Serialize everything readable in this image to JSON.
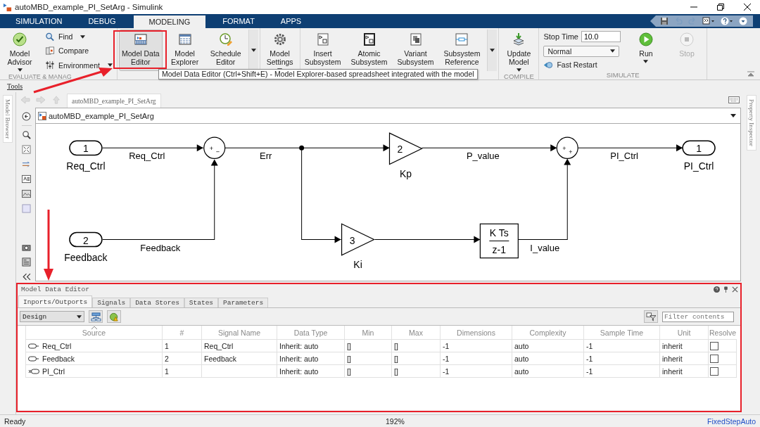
{
  "window": {
    "title": "autoMBD_example_PI_SetArg - Simulink"
  },
  "ribbon_tabs": [
    {
      "label": "SIMULATION",
      "selected": false
    },
    {
      "label": "DEBUG",
      "selected": false
    },
    {
      "label": "MODELING",
      "selected": true
    },
    {
      "label": "FORMAT",
      "selected": false
    },
    {
      "label": "APPS",
      "selected": false
    }
  ],
  "toolstrip": {
    "sections": [
      {
        "label": "EVALUATE & MANAG",
        "items": [
          {
            "kind": "big",
            "label": "Model\nAdvisor",
            "dropdown": true,
            "hovered": false,
            "disabled": false
          },
          {
            "kind": "small",
            "label": "Find",
            "dropdown": true
          },
          {
            "kind": "small",
            "label": "Compare",
            "dropdown": false
          },
          {
            "kind": "small",
            "label": "Environment",
            "dropdown": true
          }
        ]
      },
      {
        "items": [
          {
            "kind": "big",
            "label": "Model Data\nEditor",
            "dropdown": false,
            "hovered": true,
            "disabled": false
          },
          {
            "kind": "big",
            "label": "Model\nExplorer",
            "dropdown": false,
            "hovered": false,
            "disabled": false
          },
          {
            "kind": "big",
            "label": "Schedule\nEditor",
            "dropdown": false,
            "hovered": false,
            "disabled": false
          },
          {
            "kind": "more"
          }
        ]
      },
      {
        "items": [
          {
            "kind": "big",
            "label": "Model\nSettings",
            "dropdown": true,
            "hovered": false,
            "disabled": false
          }
        ]
      },
      {
        "items": [
          {
            "kind": "big",
            "label": "Insert\nSubsystem",
            "dropdown": false,
            "hovered": false,
            "disabled": false
          },
          {
            "kind": "big",
            "label": "Atomic\nSubsystem",
            "dropdown": false,
            "hovered": false,
            "disabled": false
          },
          {
            "kind": "big",
            "label": "Variant\nSubsystem",
            "dropdown": false,
            "hovered": false,
            "disabled": false
          },
          {
            "kind": "big",
            "label": "Subsystem\nReference",
            "dropdown": false,
            "hovered": false,
            "disabled": false
          },
          {
            "kind": "more"
          }
        ]
      },
      {
        "label": "COMPILE",
        "items": [
          {
            "kind": "big",
            "label": "Update\nModel",
            "dropdown": true,
            "hovered": false,
            "disabled": false
          }
        ]
      },
      {
        "label": "SIMULATE",
        "items": [
          {
            "kind": "stop_time",
            "label": "Stop Time",
            "value": "10.0"
          },
          {
            "kind": "select",
            "value": "Normal"
          },
          {
            "kind": "small",
            "label": "Fast Restart",
            "dropdown": false
          },
          {
            "kind": "big",
            "label": "Run",
            "dropdown": true,
            "hovered": false,
            "disabled": false
          },
          {
            "kind": "big",
            "label": "Stop",
            "dropdown": false,
            "hovered": false,
            "disabled": true
          }
        ]
      }
    ]
  },
  "tooltip": "Model Data Editor (Ctrl+Shift+E) - Model Explorer-based spreadsheet integrated with the model",
  "tools_label": "Tools",
  "side_tabs": {
    "left": "Model Browser",
    "right": "Property Inspector"
  },
  "editor": {
    "breadcrumb_tab": "autoMBD_example_PI_SetArg",
    "address": "autoMBD_example_PI_SetArg"
  },
  "diagram": {
    "blocks": [
      {
        "kind": "inport",
        "number": "1",
        "name": "Req_Ctrl"
      },
      {
        "kind": "inport",
        "number": "2",
        "name": "Feedback"
      },
      {
        "kind": "sum",
        "signs": [
          "+",
          "−"
        ]
      },
      {
        "kind": "gain",
        "value": "2",
        "name": "Kp"
      },
      {
        "kind": "gain",
        "value": "3",
        "name": "Ki"
      },
      {
        "kind": "discrete_integrator",
        "numerator": "K Ts",
        "denominator": "z-1"
      },
      {
        "kind": "sum",
        "signs": [
          "+",
          "+"
        ]
      },
      {
        "kind": "outport",
        "number": "1",
        "name": "PI_Ctrl"
      }
    ],
    "signals": [
      {
        "label": "Req_Ctrl"
      },
      {
        "label": "Feedback"
      },
      {
        "label": "Err"
      },
      {
        "label": "P_value"
      },
      {
        "label": "I_value"
      },
      {
        "label": "PI_Ctrl"
      }
    ]
  },
  "model_data_editor": {
    "title": "Model Data Editor",
    "tabs": [
      {
        "label": "Inports/Outports",
        "selected": true
      },
      {
        "label": "Signals",
        "selected": false
      },
      {
        "label": "Data Stores",
        "selected": false
      },
      {
        "label": "States",
        "selected": false
      },
      {
        "label": "Parameters",
        "selected": false
      }
    ],
    "view": "Design",
    "filter_placeholder": "Filter contents",
    "columns": [
      "Source",
      "#",
      "Signal Name",
      "Data Type",
      "Min",
      "Max",
      "Dimensions",
      "Complexity",
      "Sample Time",
      "Unit",
      "Resolve"
    ],
    "rows": [
      {
        "kind": "inport",
        "cells": [
          "Req_Ctrl",
          "1",
          "Req_Ctrl",
          "Inherit: auto",
          "[]",
          "[]",
          "-1",
          "auto",
          "-1",
          "inherit"
        ],
        "resolve": false
      },
      {
        "kind": "inport",
        "cells": [
          "Feedback",
          "2",
          "Feedback",
          "Inherit: auto",
          "[]",
          "[]",
          "-1",
          "auto",
          "-1",
          "inherit"
        ],
        "resolve": false
      },
      {
        "kind": "outport",
        "cells": [
          "PI_Ctrl",
          "1",
          null,
          "Inherit: auto",
          "[]",
          "[]",
          "-1",
          "auto",
          "-1",
          "inherit"
        ],
        "resolve": false
      }
    ]
  },
  "status_bar": {
    "state": "Ready",
    "zoom": "192%",
    "solver": "FixedStepAuto"
  }
}
